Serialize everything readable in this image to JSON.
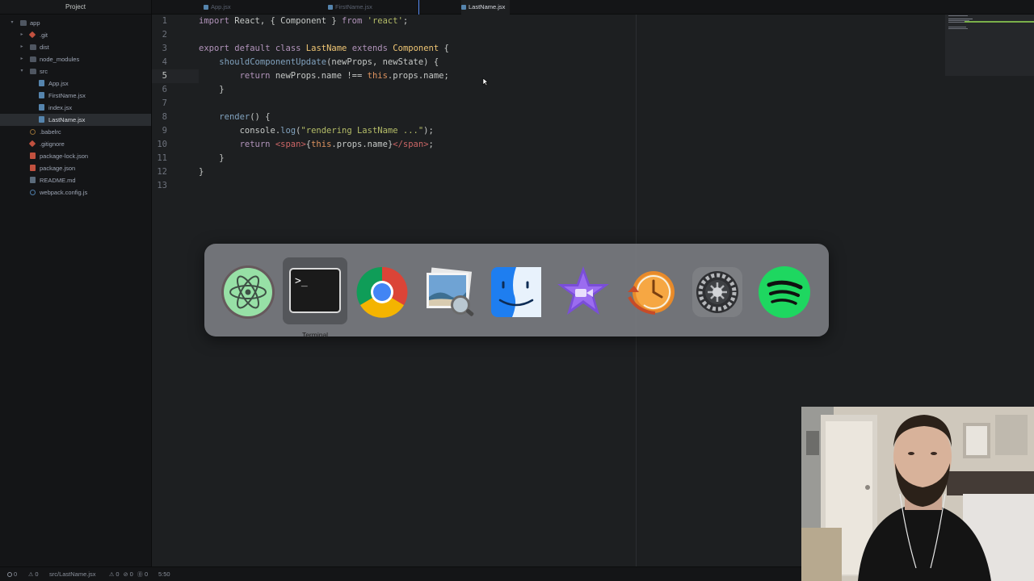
{
  "sidebar": {
    "title": "Project",
    "items": [
      {
        "label": "app",
        "chev": "▾",
        "icon": "folder-icon",
        "depth": 0
      },
      {
        "label": ".git",
        "chev": "▸",
        "icon": "git-icon",
        "depth": 1
      },
      {
        "label": "dist",
        "chev": "▸",
        "icon": "folder-icon",
        "depth": 1
      },
      {
        "label": "node_modules",
        "chev": "▸",
        "icon": "folder-icon",
        "depth": 1
      },
      {
        "label": "src",
        "chev": "▾",
        "icon": "folder-icon",
        "depth": 1
      },
      {
        "label": "App.jsx",
        "chev": "",
        "icon": "jsx-file-icon",
        "depth": 2
      },
      {
        "label": "FirstName.jsx",
        "chev": "",
        "icon": "jsx-file-icon",
        "depth": 2
      },
      {
        "label": "index.jsx",
        "chev": "",
        "icon": "jsx-file-icon",
        "depth": 2
      },
      {
        "label": "LastName.jsx",
        "chev": "",
        "icon": "jsx-file-icon",
        "depth": 2,
        "selected": true
      },
      {
        "label": ".babelrc",
        "chev": "",
        "icon": "babelrc-icon",
        "depth": 1
      },
      {
        "label": ".gitignore",
        "chev": "",
        "icon": "git-icon",
        "depth": 1
      },
      {
        "label": "package-lock.json",
        "chev": "",
        "icon": "npm-file-icon",
        "depth": 1
      },
      {
        "label": "package.json",
        "chev": "",
        "icon": "npm-file-icon",
        "depth": 1
      },
      {
        "label": "README.md",
        "chev": "",
        "icon": "markdown-file-icon",
        "depth": 1
      },
      {
        "label": "webpack.config.js",
        "chev": "",
        "icon": "config-file-icon",
        "depth": 1
      }
    ]
  },
  "tabs": [
    {
      "label": "App.jsx",
      "icon": "jsx-file-icon",
      "active": false
    },
    {
      "label": "FirstName.jsx",
      "icon": "jsx-file-icon",
      "active": false
    },
    {
      "label": "LastName.jsx",
      "icon": "jsx-file-icon",
      "active": true
    }
  ],
  "editor": {
    "current_line": 5,
    "line_numbers": [
      "1",
      "2",
      "3",
      "4",
      "5",
      "6",
      "7",
      "8",
      "9",
      "10",
      "11",
      "12",
      "13"
    ],
    "lines": [
      "import React, { Component } from 'react';",
      "",
      "export default class LastName extends Component {",
      "    shouldComponentUpdate(newProps, newState) {",
      "        return newProps.name !== this.props.name;",
      "    }",
      "",
      "    render() {",
      "        console.log(\"rendering LastName ...\");",
      "        return <span>{this.props.name}</span>;",
      "    }",
      "}",
      ""
    ]
  },
  "app_switcher": {
    "selected_app": "Terminal",
    "apps": [
      {
        "name": "Atom",
        "icon": "atom-icon"
      },
      {
        "name": "Terminal",
        "icon": "terminal-icon"
      },
      {
        "name": "Google Chrome",
        "icon": "chrome-icon"
      },
      {
        "name": "Preview",
        "icon": "preview-icon"
      },
      {
        "name": "Finder",
        "icon": "finder-icon"
      },
      {
        "name": "iMovie",
        "icon": "imovie-icon"
      },
      {
        "name": "Time Machine",
        "icon": "time-machine-icon"
      },
      {
        "name": "System Preferences",
        "icon": "system-preferences-icon"
      },
      {
        "name": "Spotify",
        "icon": "spotify-icon"
      }
    ]
  },
  "statusbar": {
    "errors": "0",
    "warnings": "0",
    "file_path": "src/LastName.jsx",
    "lint_a": "0",
    "lint_b": "0",
    "lint_c": "0",
    "cursor_position": "5:50"
  },
  "colors": {
    "editor_bg": "#1d1f21",
    "keyword": "#b294bb",
    "class_name": "#f0c674",
    "string": "#b5bd68",
    "function": "#81a2be",
    "tag": "#cc6666"
  }
}
